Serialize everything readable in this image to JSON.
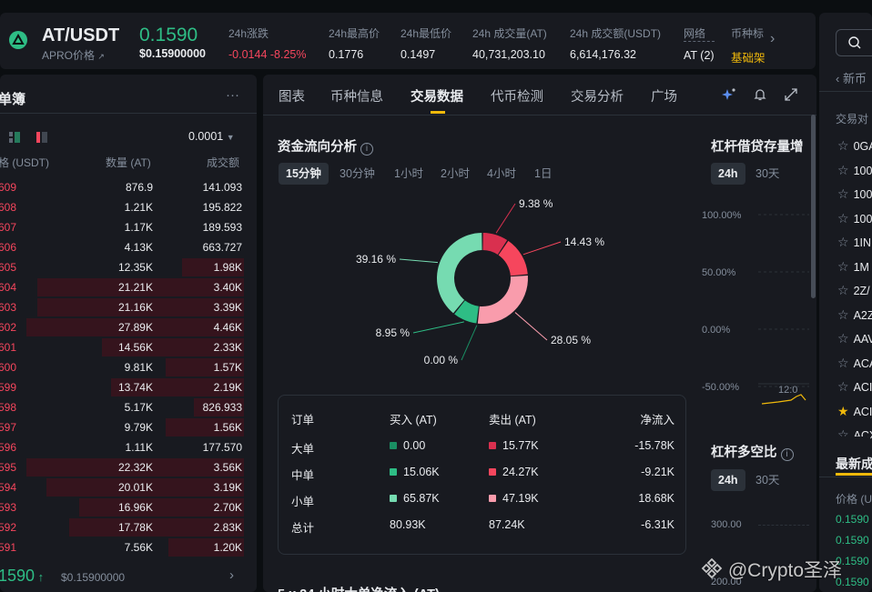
{
  "header": {
    "pair": "AT/USDT",
    "subtitle": "APRO价格",
    "price": "0.1590",
    "price_usd": "$0.15900000",
    "stats": [
      {
        "label": "24h涨跌",
        "value": "-0.0144 -8.25%",
        "color": "#f6465d"
      },
      {
        "label": "24h最高价",
        "value": "0.1776"
      },
      {
        "label": "24h最低价",
        "value": "0.1497"
      },
      {
        "label": "24h 成交量(AT)",
        "value": "40,731,203.10"
      },
      {
        "label": "24h 成交额(USDT)",
        "value": "6,614,176.32"
      },
      {
        "label": "网络",
        "value": "AT (2)"
      },
      {
        "label": "币种标",
        "value": "基础架",
        "color": "#f0b90b"
      }
    ]
  },
  "orderbook": {
    "title": "单簿",
    "more": "···",
    "precision": "0.0001",
    "col_price": "格 (USDT)",
    "col_qty": "数量 (AT)",
    "col_total": "成交额",
    "rows": [
      {
        "p": "609",
        "q": "876.9",
        "t": "141.093",
        "d": 0
      },
      {
        "p": "608",
        "q": "1.21K",
        "t": "195.822",
        "d": 0
      },
      {
        "p": "607",
        "q": "1.17K",
        "t": "189.593",
        "d": 0
      },
      {
        "p": "606",
        "q": "4.13K",
        "t": "663.727",
        "d": 0
      },
      {
        "p": "605",
        "q": "12.35K",
        "t": "1.98K",
        "d": 0.27
      },
      {
        "p": "604",
        "q": "21.21K",
        "t": "3.40K",
        "d": 0.9
      },
      {
        "p": "603",
        "q": "21.16K",
        "t": "3.39K",
        "d": 0.9
      },
      {
        "p": "602",
        "q": "27.89K",
        "t": "4.46K",
        "d": 0.95
      },
      {
        "p": "601",
        "q": "14.56K",
        "t": "2.33K",
        "d": 0.62
      },
      {
        "p": "600",
        "q": "9.81K",
        "t": "1.57K",
        "d": 0.34
      },
      {
        "p": "599",
        "q": "13.74K",
        "t": "2.19K",
        "d": 0.58
      },
      {
        "p": "598",
        "q": "5.17K",
        "t": "826.933",
        "d": 0.22
      },
      {
        "p": "597",
        "q": "9.79K",
        "t": "1.56K",
        "d": 0.34
      },
      {
        "p": "596",
        "q": "1.11K",
        "t": "177.570",
        "d": 0
      },
      {
        "p": "595",
        "q": "22.32K",
        "t": "3.56K",
        "d": 0.95
      },
      {
        "p": "594",
        "q": "20.01K",
        "t": "3.19K",
        "d": 0.86
      },
      {
        "p": "593",
        "q": "16.96K",
        "t": "2.70K",
        "d": 0.72
      },
      {
        "p": "592",
        "q": "17.78K",
        "t": "2.83K",
        "d": 0.76
      },
      {
        "p": "591",
        "q": "7.56K",
        "t": "1.20K",
        "d": 0.33
      }
    ],
    "last_price": "1590",
    "last_usd": "$0.15900000"
  },
  "center": {
    "tabs": [
      "图表",
      "币种信息",
      "交易数据",
      "代币检测",
      "交易分析",
      "广场"
    ],
    "active_tab": 2,
    "flow_title": "资金流向分析",
    "periods": [
      "15分钟",
      "30分钟",
      "1小时",
      "2小时",
      "4小时",
      "1日"
    ],
    "table": {
      "headers": [
        "订单",
        "买入 (AT)",
        "卖出 (AT)",
        "净流入"
      ],
      "rows": [
        {
          "label": "大单",
          "buy": "0.00",
          "sell": "15.77K",
          "net": "-15.78K"
        },
        {
          "label": "中单",
          "buy": "15.06K",
          "sell": "24.27K",
          "net": "-9.21K"
        },
        {
          "label": "小单",
          "buy": "65.87K",
          "sell": "47.19K",
          "net": "18.68K"
        },
        {
          "label": "总计",
          "buy": "80.93K",
          "sell": "87.24K",
          "net": "-6.31K"
        }
      ]
    },
    "bottom_title": "5 x 24 小时大单净流入 (AT)"
  },
  "chart_data": {
    "type": "pie",
    "title": "资金流向分析",
    "slices": [
      {
        "label": "9.38 %",
        "value": 9.38,
        "color": "#d9304f"
      },
      {
        "label": "14.43 %",
        "value": 14.43,
        "color": "#f6465d"
      },
      {
        "label": "28.05 %",
        "value": 28.05,
        "color": "#f99cac"
      },
      {
        "label": "0.00 %",
        "value": 0.0,
        "color": "#1a8f63"
      },
      {
        "label": "8.95 %",
        "value": 8.95,
        "color": "#2ebd85"
      },
      {
        "label": "39.16 %",
        "value": 39.16,
        "color": "#76dbb1"
      }
    ]
  },
  "leverage": {
    "title1": "杠杆借贷存量增",
    "title2": "杠杆多空比",
    "periods": [
      "24h",
      "30天"
    ],
    "y_ticks1": [
      "100.00%",
      "50.00%",
      "0.00%",
      "-50.00%"
    ],
    "x_tick1": "12:0",
    "y_ticks2": [
      "300.00",
      "200.00"
    ]
  },
  "right": {
    "search_back": "新币",
    "section_title": "交易对",
    "items": [
      "0GA",
      "100",
      "100",
      "100",
      "1IN",
      "1M",
      "2Z/",
      "A2Z",
      "AAV",
      "ACA",
      "ACI",
      "ACI",
      "ACX"
    ],
    "starred_index": 11,
    "latest_title": "最新成",
    "price_col": "价格 (U",
    "latest_prices": [
      "0.1590",
      "0.1590",
      "0.1590",
      "0.1590"
    ]
  },
  "watermark": "@Crypto圣泽"
}
